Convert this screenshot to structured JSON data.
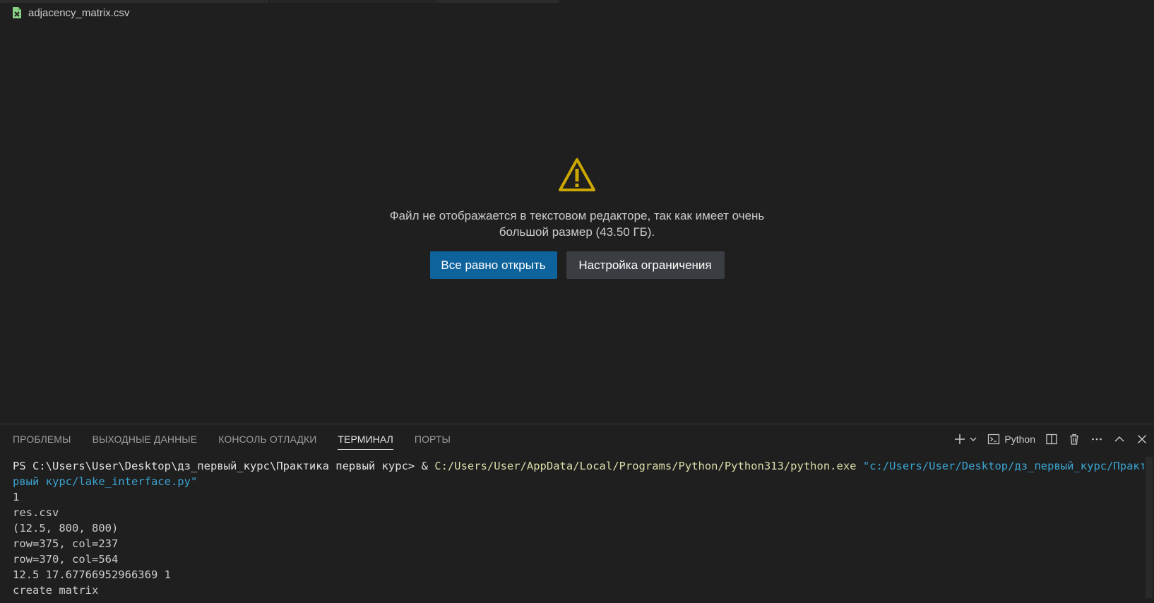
{
  "editor": {
    "file_name": "adjacency_matrix.csv",
    "warning": {
      "message_line1": "Файл не отображается в текстовом редакторе, так как имеет очень",
      "message_line2": "большой размер (43.50 ГБ).",
      "open_anyway_label": "Все равно открыть",
      "configure_limit_label": "Настройка ограничения"
    },
    "colors": {
      "warning": "#cca700",
      "primary_button": "#0e639c",
      "secondary_button": "#3a3d41"
    }
  },
  "panel": {
    "tabs": [
      {
        "label": "ПРОБЛЕМЫ",
        "active": false
      },
      {
        "label": "ВЫХОДНЫЕ ДАННЫЕ",
        "active": false
      },
      {
        "label": "КОНСОЛЬ ОТЛАДКИ",
        "active": false
      },
      {
        "label": "ТЕРМИНАЛ",
        "active": true
      },
      {
        "label": "ПОРТЫ",
        "active": false
      }
    ],
    "actions": {
      "terminal_profile": "Python",
      "icons": [
        "plus-icon",
        "chevron-down-icon",
        "terminal-icon",
        "split-icon",
        "trash-icon",
        "more-icon",
        "chevron-up-icon",
        "close-icon"
      ]
    }
  },
  "terminal": {
    "prompt": "PS C:\\Users\\User\\Desktop\\дз_первый_курс\\Практика первый курс> ",
    "operator": "& ",
    "exe_path": "C:/Users/User/AppData/Local/Programs/Python/Python313/python.exe",
    "script_arg_part1": "\"c:/Users/User/Desktop/дз_первый_курс/Практика пе",
    "script_arg_part2": "рвый курс/lake_interface.py\"",
    "output_lines": [
      "1",
      "res.csv",
      "(12.5, 800, 800)",
      "row=375, col=237",
      "row=370, col=564",
      "12.5 17.67766952966369 1",
      "create matrix"
    ]
  }
}
